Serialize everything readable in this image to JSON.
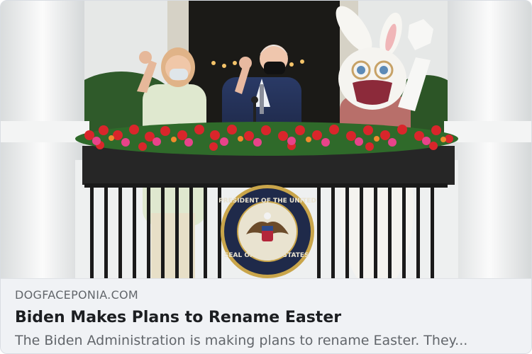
{
  "link_preview": {
    "domain": "DOGFACEPONIA.COM",
    "title": "Biden Makes Plans to Rename Easter",
    "description": "The Biden Administration is making plans to rename Easter. They..."
  },
  "seal": {
    "top_text": "PRESIDENT OF THE UNITED",
    "left_text": "SEAL OF",
    "right_text": "STATES"
  },
  "colors": {
    "flowers_red": "#d9262b",
    "flowers_pink": "#e8438a",
    "seal_navy": "#1f2a4a",
    "seal_gold": "#c9a54a",
    "mask_maroon": "#8c2a3a"
  }
}
